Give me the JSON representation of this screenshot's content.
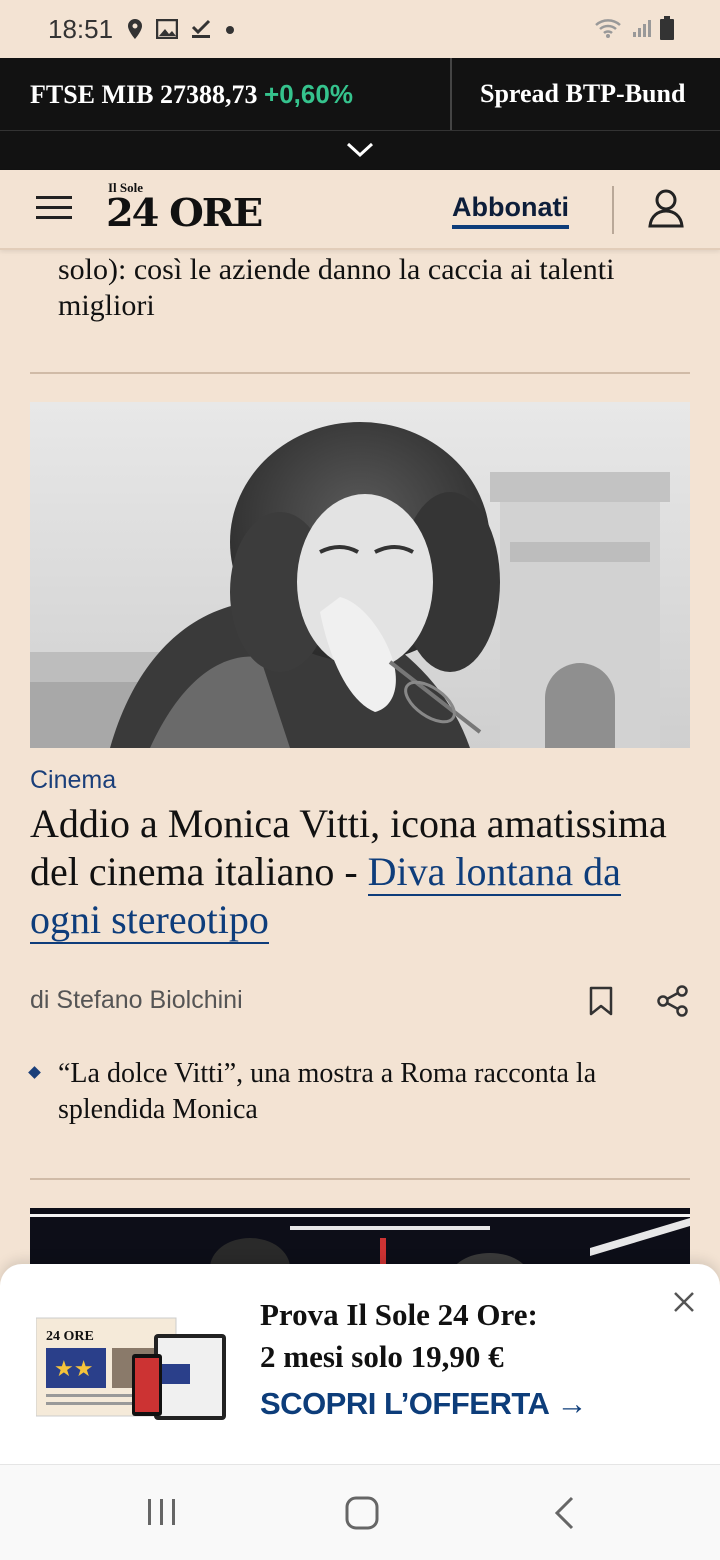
{
  "status_bar": {
    "time": "18:51",
    "icons": [
      "location-icon",
      "gallery-icon",
      "download-done-icon",
      "dot-icon",
      "wifi-icon",
      "signal-icon",
      "battery-icon"
    ]
  },
  "ticker": {
    "index_name": "FTSE MIB",
    "index_value": "27388,73",
    "index_change": "+0,60%",
    "next_item": "Spread BTP-Bund"
  },
  "header": {
    "logo_small": "Il Sole",
    "logo_big": "24 ORE",
    "subscribe_label": "Abbonati"
  },
  "previous_article": {
    "title_tail": "solo): così le aziende danno la caccia ai talenti migliori"
  },
  "article": {
    "category": "Cinema",
    "headline": "Addio a Monica Vitti, icona amatissima del cinema italiano - ",
    "headline_link": "Diva lontana da ogni stereotipo",
    "author": "di Stefano Biolchini",
    "related": "“La dolce Vitti”, una mostra a Roma racconta la splendida Monica"
  },
  "promo": {
    "line1": "Prova Il Sole 24 Ore:",
    "line2": "2 mesi solo 19,90 €",
    "cta": "SCOPRI L’OFFERTA →"
  },
  "colors": {
    "background": "#f3e3d3",
    "ticker_bg": "#121212",
    "positive_change": "#35c38d",
    "link_blue": "#0e3d7b"
  }
}
